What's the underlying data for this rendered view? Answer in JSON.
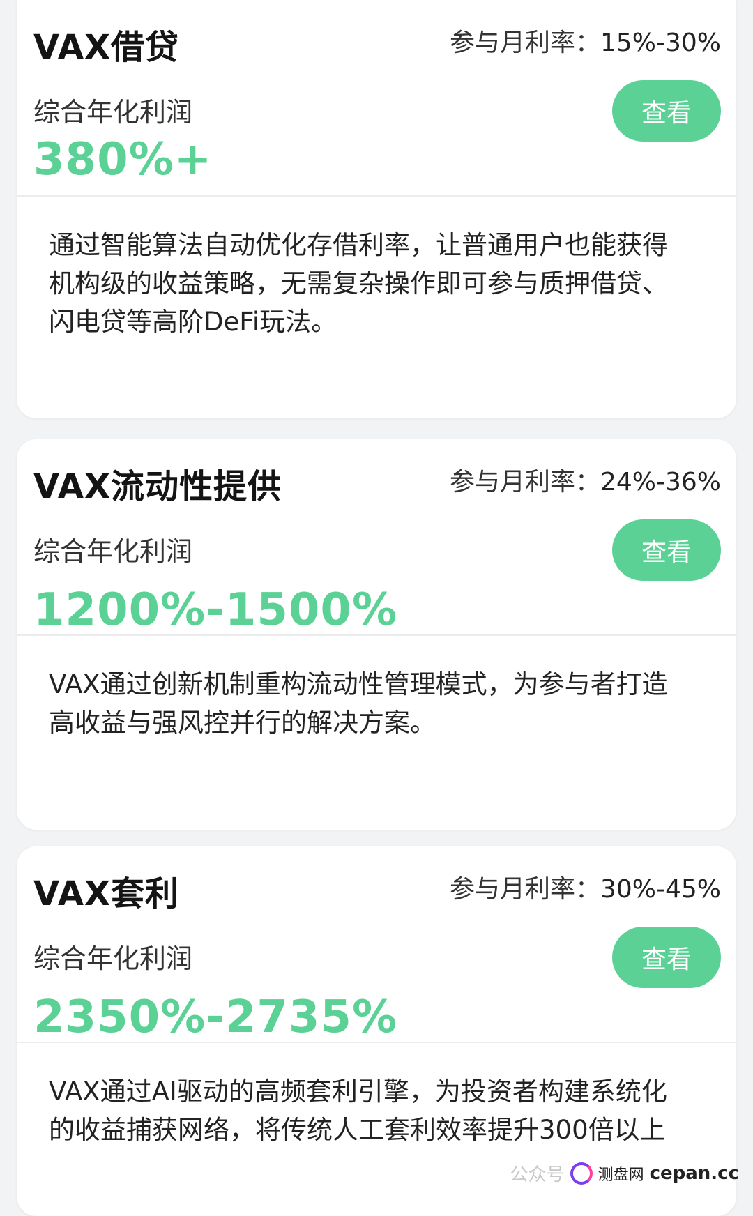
{
  "cards": [
    {
      "title": "VAX借贷",
      "rate_label": "参与月利率：",
      "rate_value": "15%-30%",
      "subtitle": "综合年化利润",
      "profit": "380%+",
      "button": "查看",
      "description": "通过智能算法自动优化存借利率，让普通用户也能获得机构级的收益策略，无需复杂操作即可参与质押借贷、闪电贷等高阶DeFi玩法。"
    },
    {
      "title": "VAX流动性提供",
      "rate_label": "参与月利率：",
      "rate_value": "24%-36%",
      "subtitle": "综合年化利润",
      "profit": "1200%-1500%",
      "button": "查看",
      "description": "VAX通过创新机制重构流动性管理模式，为参与者打造高收益与强风控并行的解决方案。"
    },
    {
      "title": "VAX套利",
      "rate_label": "参与月利率：",
      "rate_value": "30%-45%",
      "subtitle": "综合年化利润",
      "profit": "2350%-2735%",
      "button": "查看",
      "description": "VAX通过AI驱动的高频套利引擎，为投资者构建系统化的收益捕获网络，将传统人工套利效率提升300倍以上"
    }
  ],
  "watermark": {
    "site_name": "测盘网",
    "domain": "cepan.cc",
    "faint_text": "公众号"
  }
}
